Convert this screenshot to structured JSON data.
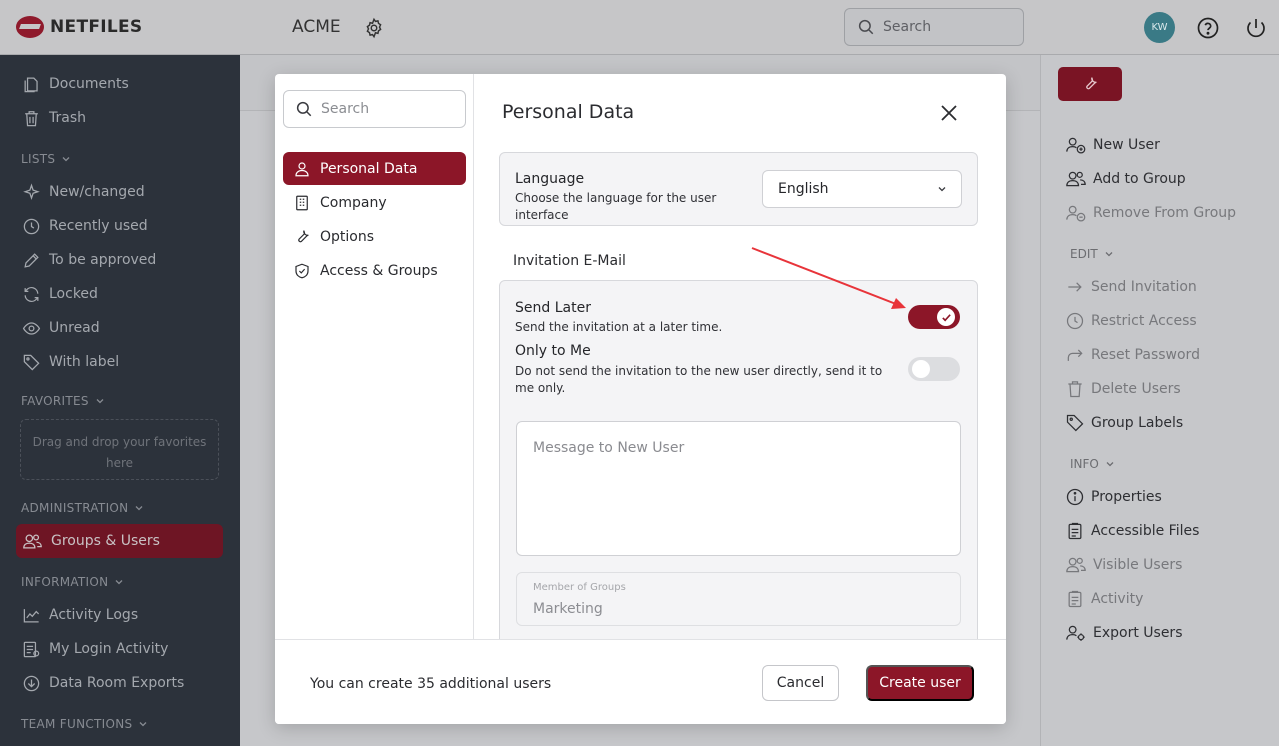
{
  "header": {
    "logo_text": "NETFILES",
    "app_title": "ACME",
    "search_placeholder": "Search",
    "avatar_initials": "KW"
  },
  "sidebar": {
    "items": [
      {
        "label": "Documents",
        "icon": "document-icon"
      },
      {
        "label": "Trash",
        "icon": "trash-icon"
      }
    ],
    "lists_section": "LISTS",
    "list_items": [
      {
        "label": "New/changed",
        "icon": "sparkle-icon"
      },
      {
        "label": "Recently used",
        "icon": "clock-icon"
      },
      {
        "label": "To be approved",
        "icon": "pencil-icon"
      },
      {
        "label": "Locked",
        "icon": "refresh-icon"
      },
      {
        "label": "Unread",
        "icon": "eye-icon"
      },
      {
        "label": "With label",
        "icon": "tag-icon"
      }
    ],
    "favorites_section": "FAVORITES",
    "favorites_drop_text": "Drag and drop your favorites here",
    "administration_section": "ADMINISTRATION",
    "administration_items": [
      {
        "label": "Groups & Users",
        "icon": "users-icon"
      }
    ],
    "information_section": "INFORMATION",
    "information_items": [
      {
        "label": "Activity Logs",
        "icon": "chart-icon"
      },
      {
        "label": "My Login Activity",
        "icon": "list-icon"
      },
      {
        "label": "Data Room Exports",
        "icon": "download-icon"
      }
    ],
    "team_functions_section": "TEAM FUNCTIONS"
  },
  "right_panel": {
    "items": [
      {
        "label": "New User",
        "icon": "user-plus-icon",
        "enabled": true
      },
      {
        "label": "Add to Group",
        "icon": "users-icon",
        "enabled": true
      },
      {
        "label": "Remove From Group",
        "icon": "user-minus-icon",
        "enabled": false
      }
    ],
    "edit_section": "EDIT",
    "edit_items": [
      {
        "label": "Send Invitation",
        "icon": "arrow-right-icon",
        "enabled": false
      },
      {
        "label": "Restrict Access",
        "icon": "clock-icon",
        "enabled": false
      },
      {
        "label": "Reset Password",
        "icon": "forward-icon",
        "enabled": false
      },
      {
        "label": "Delete Users",
        "icon": "trash-icon",
        "enabled": false
      },
      {
        "label": "Group Labels",
        "icon": "tag-icon",
        "enabled": true
      }
    ],
    "info_section": "INFO",
    "info_items": [
      {
        "label": "Properties",
        "icon": "info-icon",
        "enabled": true
      },
      {
        "label": "Accessible Files",
        "icon": "clipboard-icon",
        "enabled": true
      },
      {
        "label": "Visible Users",
        "icon": "users-icon",
        "enabled": false
      },
      {
        "label": "Activity",
        "icon": "clipboard-icon",
        "enabled": false
      },
      {
        "label": "Export Users",
        "icon": "users-gear-icon",
        "enabled": true
      }
    ]
  },
  "modal": {
    "nav_search_placeholder": "Search",
    "nav_items": [
      {
        "label": "Personal Data",
        "icon": "person-icon",
        "active": true
      },
      {
        "label": "Company",
        "icon": "building-icon",
        "active": false
      },
      {
        "label": "Options",
        "icon": "wrench-icon",
        "active": false
      },
      {
        "label": "Access & Groups",
        "icon": "shield-icon",
        "active": false
      }
    ],
    "title": "Personal Data",
    "language": {
      "label": "Language",
      "description": "Choose the language for the user interface",
      "selected": "English"
    },
    "invitation_heading": "Invitation E-Mail",
    "send_later": {
      "label": "Send Later",
      "description": "Send the invitation at a later time.",
      "enabled": true
    },
    "only_to_me": {
      "label": "Only to Me",
      "description": "Do not send the invitation to the new user directly, send it to me only.",
      "enabled": false
    },
    "message_placeholder": "Message to New User",
    "member_of_groups_label": "Member of Groups",
    "member_of_groups_value": "Marketing",
    "footer_text": "You can create 35 additional users",
    "cancel_label": "Cancel",
    "create_label": "Create user"
  },
  "colors": {
    "accent": "#8c1628",
    "sidebar_bg": "#2c323b",
    "annotation_arrow": "#e8343a"
  }
}
